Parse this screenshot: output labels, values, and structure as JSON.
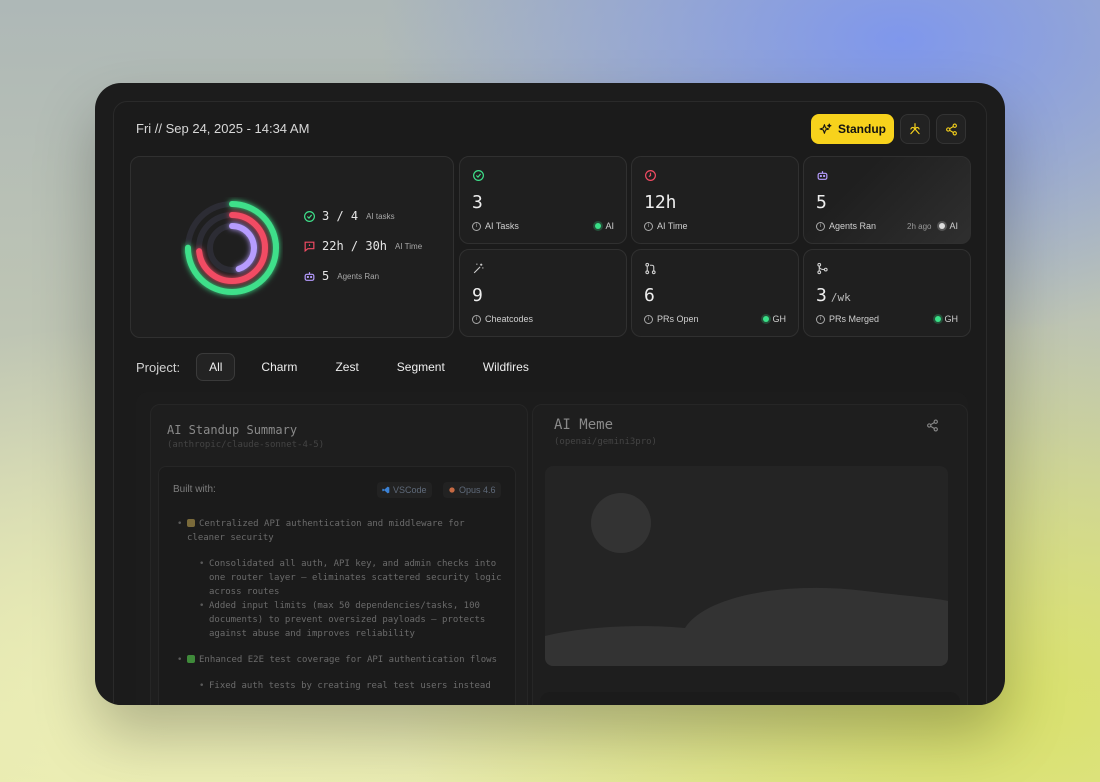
{
  "header": {
    "date": "Fri // Sep 24, 2025 - 14:34 AM",
    "standup_label": "Standup",
    "icons": [
      "sparkle-icon",
      "claude-icon",
      "share-icon"
    ]
  },
  "summary": {
    "ai_tasks": {
      "value": "3 / 4",
      "label": "AI tasks",
      "completed": 3,
      "total": 4
    },
    "ai_time": {
      "value": "22h / 30h",
      "label": "AI Time",
      "used": 22,
      "total": 30
    },
    "agents": {
      "value": "5",
      "label": "Agents Ran"
    }
  },
  "stats": [
    {
      "icon": "check-circle-icon",
      "value": "3",
      "suffix": "",
      "label": "AI Tasks",
      "ago": "",
      "tag": "AI",
      "tag_color": "#39e087"
    },
    {
      "icon": "clock-icon",
      "value": "12h",
      "suffix": "",
      "label": "AI Time",
      "ago": "",
      "tag": "",
      "tag_color": ""
    },
    {
      "icon": "robot-icon",
      "value": "5",
      "suffix": "",
      "label": "Agents Ran",
      "ago": "2h ago",
      "tag": "AI",
      "tag_color": "#dddddd"
    },
    {
      "icon": "magic-wand-icon",
      "value": "9",
      "suffix": "",
      "label": "Cheatcodes",
      "ago": "",
      "tag": "",
      "tag_color": ""
    },
    {
      "icon": "pull-request-icon",
      "value": "6",
      "suffix": "",
      "label": "PRs Open",
      "ago": "",
      "tag": "GH",
      "tag_color": "#39e087"
    },
    {
      "icon": "merge-icon",
      "value": "3",
      "suffix": "/wk",
      "label": "PRs Merged",
      "ago": "",
      "tag": "GH",
      "tag_color": "#39e087"
    }
  ],
  "project": {
    "label": "Project:",
    "tabs": [
      "All",
      "Charm",
      "Zest",
      "Segment",
      "Wildfires"
    ],
    "active": "All"
  },
  "standup_summary": {
    "title": "AI Standup Summary",
    "model": "(anthropic/claude-sonnet-4-5)",
    "built_with_label": "Built with:",
    "chips": [
      "VSCode",
      "Opus 4.6"
    ],
    "notes": [
      {
        "text": "Centralized API authentication and middleware for cleaner security",
        "emoji": "lock"
      },
      {
        "text": "Consolidated all auth, API key, and admin checks into one router layer – eliminates scattered security logic across routes",
        "sub": true
      },
      {
        "text": "Added input limits (max 50 dependencies/tasks, 100 documents) to prevent oversized payloads – protects against abuse and improves reliability",
        "sub": true
      },
      {
        "text": "Enhanced E2E test coverage for API authentication flows",
        "emoji": "check"
      },
      {
        "text": "Fixed auth tests by creating real test users instead",
        "sub": true
      }
    ]
  },
  "meme": {
    "title": "AI Meme",
    "model": "(openai/gemini3pro)"
  },
  "colors": {
    "accent": "#f7d21c",
    "ring_green": "#3ee08a",
    "ring_red": "#f24b63",
    "ring_purple": "#b69cff"
  }
}
